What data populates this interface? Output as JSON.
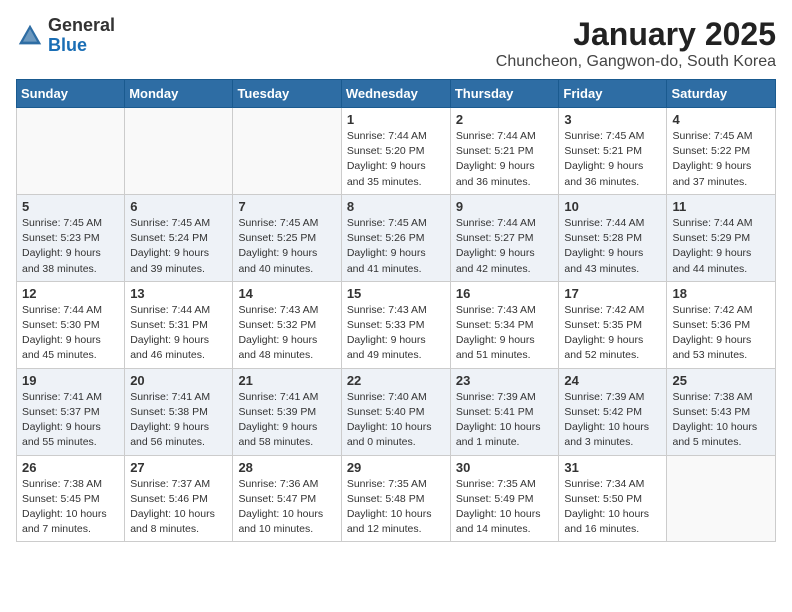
{
  "header": {
    "logo_general": "General",
    "logo_blue": "Blue",
    "month_title": "January 2025",
    "location": "Chuncheon, Gangwon-do, South Korea"
  },
  "weekdays": [
    "Sunday",
    "Monday",
    "Tuesday",
    "Wednesday",
    "Thursday",
    "Friday",
    "Saturday"
  ],
  "weeks": [
    [
      {
        "day": "",
        "info": ""
      },
      {
        "day": "",
        "info": ""
      },
      {
        "day": "",
        "info": ""
      },
      {
        "day": "1",
        "info": "Sunrise: 7:44 AM\nSunset: 5:20 PM\nDaylight: 9 hours and 35 minutes."
      },
      {
        "day": "2",
        "info": "Sunrise: 7:44 AM\nSunset: 5:21 PM\nDaylight: 9 hours and 36 minutes."
      },
      {
        "day": "3",
        "info": "Sunrise: 7:45 AM\nSunset: 5:21 PM\nDaylight: 9 hours and 36 minutes."
      },
      {
        "day": "4",
        "info": "Sunrise: 7:45 AM\nSunset: 5:22 PM\nDaylight: 9 hours and 37 minutes."
      }
    ],
    [
      {
        "day": "5",
        "info": "Sunrise: 7:45 AM\nSunset: 5:23 PM\nDaylight: 9 hours and 38 minutes."
      },
      {
        "day": "6",
        "info": "Sunrise: 7:45 AM\nSunset: 5:24 PM\nDaylight: 9 hours and 39 minutes."
      },
      {
        "day": "7",
        "info": "Sunrise: 7:45 AM\nSunset: 5:25 PM\nDaylight: 9 hours and 40 minutes."
      },
      {
        "day": "8",
        "info": "Sunrise: 7:45 AM\nSunset: 5:26 PM\nDaylight: 9 hours and 41 minutes."
      },
      {
        "day": "9",
        "info": "Sunrise: 7:44 AM\nSunset: 5:27 PM\nDaylight: 9 hours and 42 minutes."
      },
      {
        "day": "10",
        "info": "Sunrise: 7:44 AM\nSunset: 5:28 PM\nDaylight: 9 hours and 43 minutes."
      },
      {
        "day": "11",
        "info": "Sunrise: 7:44 AM\nSunset: 5:29 PM\nDaylight: 9 hours and 44 minutes."
      }
    ],
    [
      {
        "day": "12",
        "info": "Sunrise: 7:44 AM\nSunset: 5:30 PM\nDaylight: 9 hours and 45 minutes."
      },
      {
        "day": "13",
        "info": "Sunrise: 7:44 AM\nSunset: 5:31 PM\nDaylight: 9 hours and 46 minutes."
      },
      {
        "day": "14",
        "info": "Sunrise: 7:43 AM\nSunset: 5:32 PM\nDaylight: 9 hours and 48 minutes."
      },
      {
        "day": "15",
        "info": "Sunrise: 7:43 AM\nSunset: 5:33 PM\nDaylight: 9 hours and 49 minutes."
      },
      {
        "day": "16",
        "info": "Sunrise: 7:43 AM\nSunset: 5:34 PM\nDaylight: 9 hours and 51 minutes."
      },
      {
        "day": "17",
        "info": "Sunrise: 7:42 AM\nSunset: 5:35 PM\nDaylight: 9 hours and 52 minutes."
      },
      {
        "day": "18",
        "info": "Sunrise: 7:42 AM\nSunset: 5:36 PM\nDaylight: 9 hours and 53 minutes."
      }
    ],
    [
      {
        "day": "19",
        "info": "Sunrise: 7:41 AM\nSunset: 5:37 PM\nDaylight: 9 hours and 55 minutes."
      },
      {
        "day": "20",
        "info": "Sunrise: 7:41 AM\nSunset: 5:38 PM\nDaylight: 9 hours and 56 minutes."
      },
      {
        "day": "21",
        "info": "Sunrise: 7:41 AM\nSunset: 5:39 PM\nDaylight: 9 hours and 58 minutes."
      },
      {
        "day": "22",
        "info": "Sunrise: 7:40 AM\nSunset: 5:40 PM\nDaylight: 10 hours and 0 minutes."
      },
      {
        "day": "23",
        "info": "Sunrise: 7:39 AM\nSunset: 5:41 PM\nDaylight: 10 hours and 1 minute."
      },
      {
        "day": "24",
        "info": "Sunrise: 7:39 AM\nSunset: 5:42 PM\nDaylight: 10 hours and 3 minutes."
      },
      {
        "day": "25",
        "info": "Sunrise: 7:38 AM\nSunset: 5:43 PM\nDaylight: 10 hours and 5 minutes."
      }
    ],
    [
      {
        "day": "26",
        "info": "Sunrise: 7:38 AM\nSunset: 5:45 PM\nDaylight: 10 hours and 7 minutes."
      },
      {
        "day": "27",
        "info": "Sunrise: 7:37 AM\nSunset: 5:46 PM\nDaylight: 10 hours and 8 minutes."
      },
      {
        "day": "28",
        "info": "Sunrise: 7:36 AM\nSunset: 5:47 PM\nDaylight: 10 hours and 10 minutes."
      },
      {
        "day": "29",
        "info": "Sunrise: 7:35 AM\nSunset: 5:48 PM\nDaylight: 10 hours and 12 minutes."
      },
      {
        "day": "30",
        "info": "Sunrise: 7:35 AM\nSunset: 5:49 PM\nDaylight: 10 hours and 14 minutes."
      },
      {
        "day": "31",
        "info": "Sunrise: 7:34 AM\nSunset: 5:50 PM\nDaylight: 10 hours and 16 minutes."
      },
      {
        "day": "",
        "info": ""
      }
    ]
  ]
}
